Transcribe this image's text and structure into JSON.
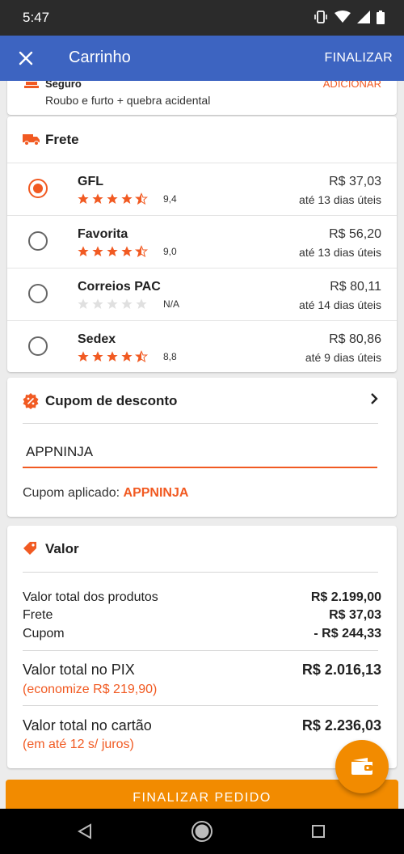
{
  "status_bar": {
    "time": "5:47",
    "icons": [
      "vibrate-icon",
      "wifi-icon",
      "signal-icon",
      "battery-icon"
    ]
  },
  "app_bar": {
    "title": "Carrinho",
    "action": "FINALIZAR",
    "close_icon": "close-icon"
  },
  "seguro": {
    "title": "Seguro",
    "description": "Roubo e furto + quebra acidental",
    "action": "ADICIONAR"
  },
  "frete": {
    "title": "Frete",
    "options": [
      {
        "name": "GFL",
        "stars": 4.5,
        "rating": "9,4",
        "price": "R$ 37,03",
        "days": "até 13 dias úteis",
        "selected": true
      },
      {
        "name": "Favorita",
        "stars": 4.5,
        "rating": "9,0",
        "price": "R$ 56,20",
        "days": "até 13 dias úteis",
        "selected": false
      },
      {
        "name": "Correios PAC",
        "stars": 0,
        "rating": "N/A",
        "price": "R$ 80,11",
        "days": "até 14 dias úteis",
        "selected": false
      },
      {
        "name": "Sedex",
        "stars": 4.5,
        "rating": "8,8",
        "price": "R$ 80,86",
        "days": "até 9 dias úteis",
        "selected": false
      }
    ]
  },
  "cupom": {
    "title": "Cupom de desconto",
    "input_value": "APPNINJA",
    "applied_label": "Cupom aplicado:",
    "applied_code": "APPNINJA"
  },
  "valor": {
    "title": "Valor",
    "lines": [
      {
        "label": "Valor total dos produtos",
        "value": "R$ 2.199,00"
      },
      {
        "label": "Frete",
        "value": "R$ 37,03"
      },
      {
        "label": "Cupom",
        "value": "- R$ 244,33"
      }
    ],
    "pix": {
      "label": "Valor total no PIX",
      "value": "R$ 2.016,13",
      "note": "(economize R$ 219,90)"
    },
    "cartao": {
      "label": "Valor total no cartão",
      "value": "R$ 2.236,03",
      "note": "(em até 12 s/ juros)"
    }
  },
  "finalizar_pedido": "FINALIZAR PEDIDO",
  "colors": {
    "primary": "#3d64c1",
    "accent": "#f15a22",
    "button": "#f28b00",
    "star": "#f15a22"
  }
}
